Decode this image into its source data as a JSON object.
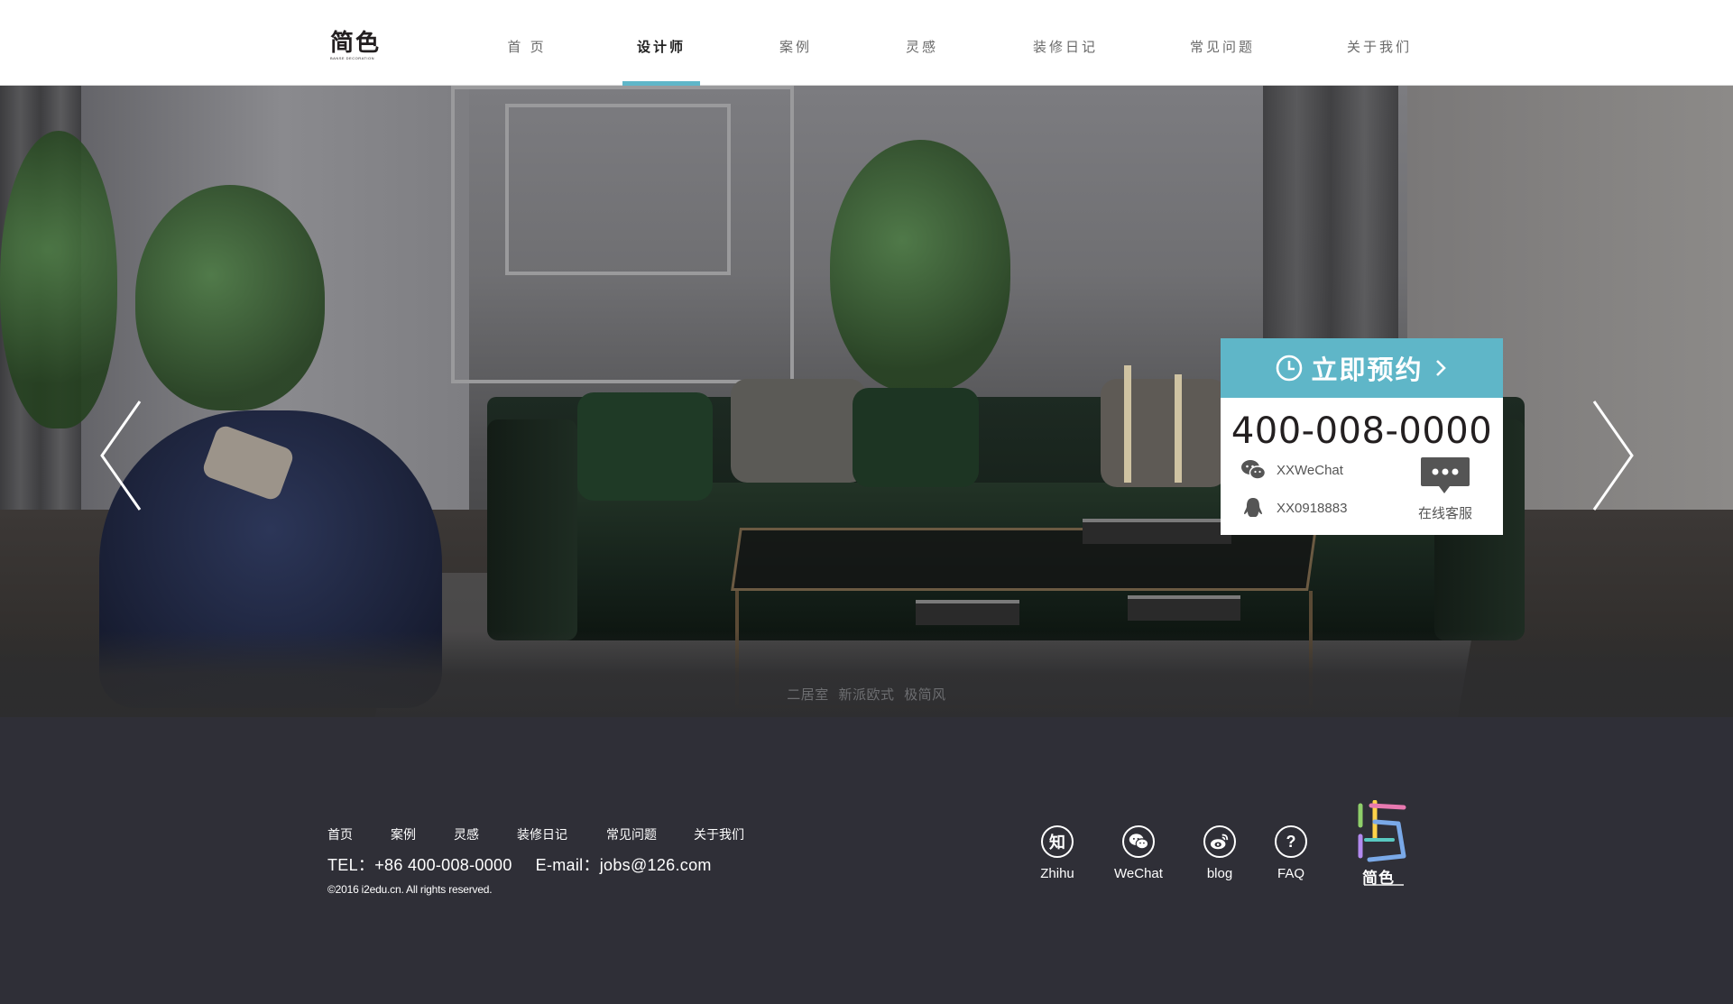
{
  "header": {
    "logo_cn": "简色",
    "logo_en": "BANSE DECORATION",
    "nav": [
      {
        "label": "首 页",
        "active": false
      },
      {
        "label": "设计师",
        "active": true
      },
      {
        "label": "案例",
        "active": false
      },
      {
        "label": "灵感",
        "active": false
      },
      {
        "label": "装修日记",
        "active": false
      },
      {
        "label": "常见问题",
        "active": false
      },
      {
        "label": "关于我们",
        "active": false
      }
    ]
  },
  "hero": {
    "caption": [
      "二居室",
      "新派欧式",
      "极简风"
    ],
    "prev_icon": "chevron-left-icon",
    "next_icon": "chevron-right-icon"
  },
  "booking": {
    "title": "立即预约",
    "phone": "400-008-0000",
    "wechat": "XXWeChat",
    "qq": "XX0918883",
    "online_service": "在线客服",
    "accent_color": "#5fb6c8"
  },
  "footer": {
    "nav": [
      "首页",
      "案例",
      "灵感",
      "装修日记",
      "常见问题",
      "关于我们"
    ],
    "tel": "TEL：+86 400-008-0000",
    "email": "E-mail：jobs@126.com",
    "copyright": "©2016 i2edu.cn. All rights reserved.",
    "social": [
      {
        "label": "Zhihu",
        "glyph": "知",
        "icon": "zhihu-icon"
      },
      {
        "label": "WeChat",
        "glyph": "",
        "icon": "wechat-icon"
      },
      {
        "label": "blog",
        "glyph": "",
        "icon": "weibo-icon"
      },
      {
        "label": "FAQ",
        "glyph": "?",
        "icon": "question-icon"
      }
    ],
    "logo_cn": "简色",
    "background_color": "#2f2f37"
  }
}
